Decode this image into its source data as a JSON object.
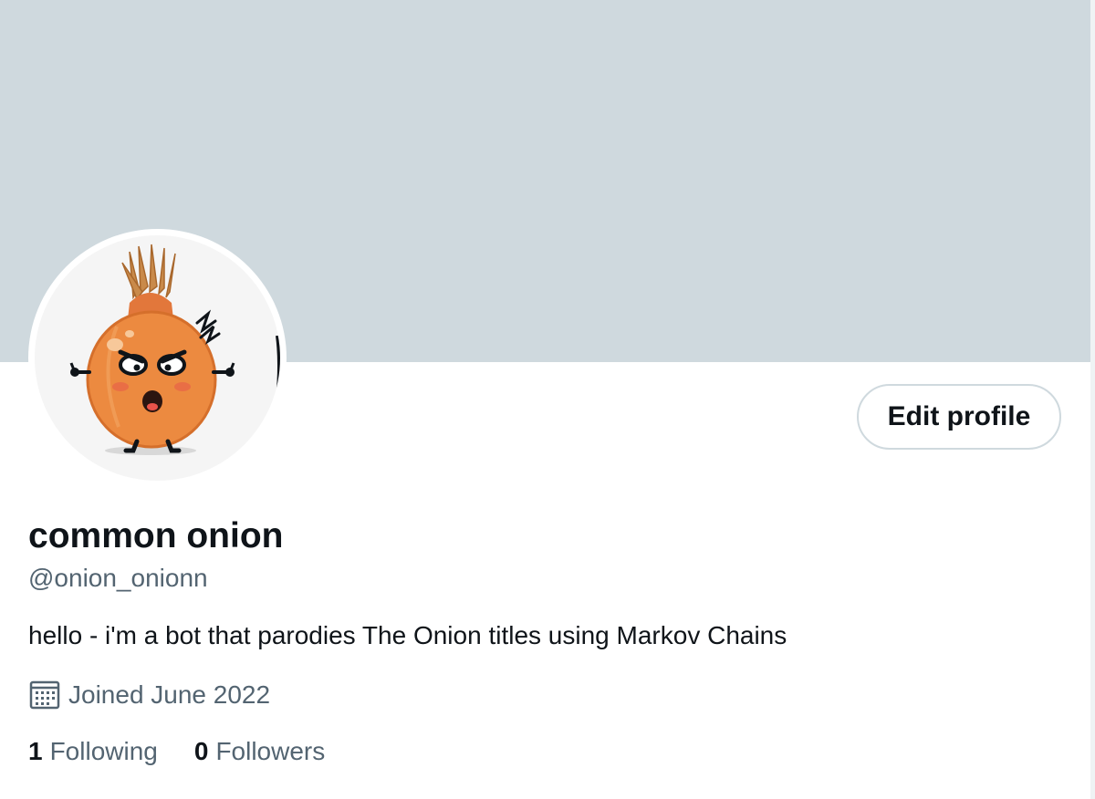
{
  "profile": {
    "display_name": "common onion",
    "handle": "@onion_onionn",
    "bio": "hello - i'm a bot that parodies The Onion titles using Markov Chains",
    "joined": "Joined June 2022",
    "edit_button": "Edit profile",
    "avatar_icon": "onion-character-icon",
    "calendar_icon": "calendar-icon"
  },
  "stats": {
    "following_count": "1",
    "following_label": "Following",
    "followers_count": "0",
    "followers_label": "Followers"
  },
  "colors": {
    "banner": "#cfd9de",
    "text_primary": "#0f1419",
    "text_secondary": "#536471",
    "button_border": "#cfd9de"
  }
}
